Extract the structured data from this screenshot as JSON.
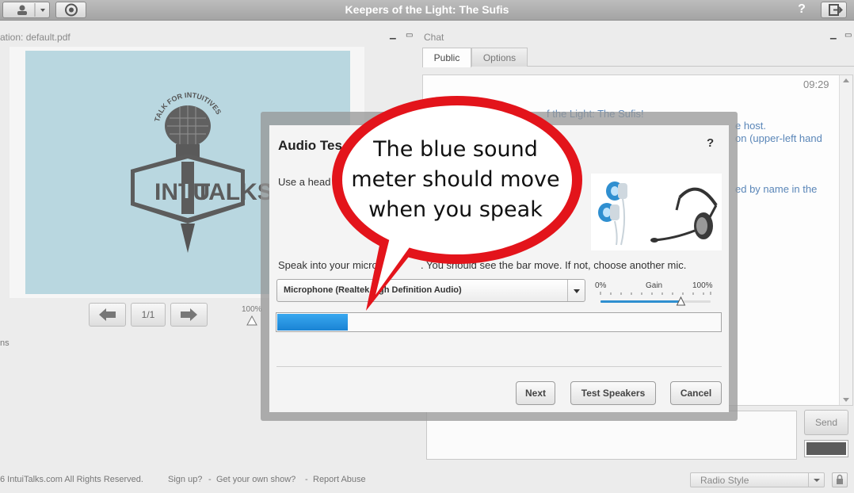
{
  "app": {
    "title": "Keepers of the Light: The Sufis",
    "help": "?"
  },
  "presentation": {
    "title": "ation: default.pdf",
    "page_indicator": "1/1",
    "zoom": "100%",
    "slide_logo_left": "INTU",
    "slide_logo_right": "TALKS",
    "slide_logo_i": "I",
    "slide_tagline": "TALK FOR INTUITIVES",
    "side_label": "ns"
  },
  "chat": {
    "title": "Chat",
    "tabs": [
      "Public",
      "Options"
    ],
    "timestamp": "09:29",
    "lines": [
      "f the Light: The Sufis!",
      "e host.",
      "on (upper-left hand",
      "ed by name in the"
    ],
    "send_label": "Send"
  },
  "dialog": {
    "title": "Audio Tes",
    "help": "?",
    "instruction": "Use a head",
    "speak_text": "Speak into your microp",
    "speak_text_2": ". You should see the bar move. If not, choose another mic.",
    "mic_value": "Microphone (Realtek",
    "mic_value_2": "gh Definition Audio)",
    "gain_min": "0%",
    "gain_label": "Gain",
    "gain_max": "100%",
    "gain_level": 0.73,
    "meter_level": 0.16,
    "buttons": {
      "next": "Next",
      "test_speakers": "Test Speakers",
      "cancel": "Cancel"
    }
  },
  "callout": {
    "line1": "The blue sound",
    "line2": "meter should move",
    "line3": "when you speak"
  },
  "footer": {
    "copyright": "6 IntuiTalks.com All Rights Reserved.",
    "sign_up": "Sign up?",
    "sep": "-",
    "get_show": "Get your own show?",
    "report": "Report Abuse",
    "style_select": "Radio Style"
  },
  "colors": {
    "meter_blue": "#1a83d4",
    "bubble_red": "#e3141b",
    "link": "#5a86b8"
  }
}
